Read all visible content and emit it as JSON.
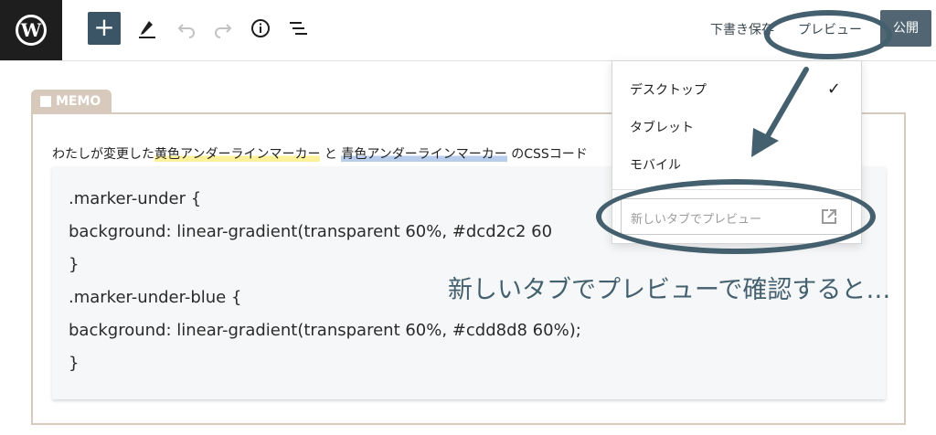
{
  "toolbar": {
    "logo_letter": "W",
    "add_glyph": "+",
    "draft_label": "下書き保存",
    "preview_label": "プレビュー",
    "publish_label": "公開"
  },
  "icons": {
    "logo": "wordpress-icon",
    "add": "plus-icon",
    "edit": "pencil-icon",
    "undo": "undo-icon",
    "redo": "redo-icon",
    "info": "info-icon",
    "outline": "list-outline-icon",
    "external": "external-link-icon"
  },
  "memo": {
    "label": "MEMO",
    "intro_start": "わたしが変更した",
    "intro_yellow": "黄色アンダーラインマーカー",
    "intro_middle": " と ",
    "intro_blue": "青色アンダーラインマーカー",
    "intro_end": " のCSSコード",
    "code_lines": [
      ".marker-under {",
      "background: linear-gradient(transparent 60%, #dcd2c2 60",
      "}",
      ".marker-under-blue {",
      "background: linear-gradient(transparent 60%, #cdd8d8 60%);",
      "}"
    ]
  },
  "dropdown": {
    "items": [
      "デスクトップ",
      "タブレット",
      "モバイル"
    ],
    "checked_glyph": "✓",
    "new_tab_label": "新しいタブでプレビュー"
  },
  "annotation": "新しいタブでプレビューで確認すると…",
  "colors": {
    "accent": "#44606e",
    "memo": "#d8c9bd",
    "marker_yellow": "#fdf19a",
    "marker_blue": "#b8cdec"
  }
}
